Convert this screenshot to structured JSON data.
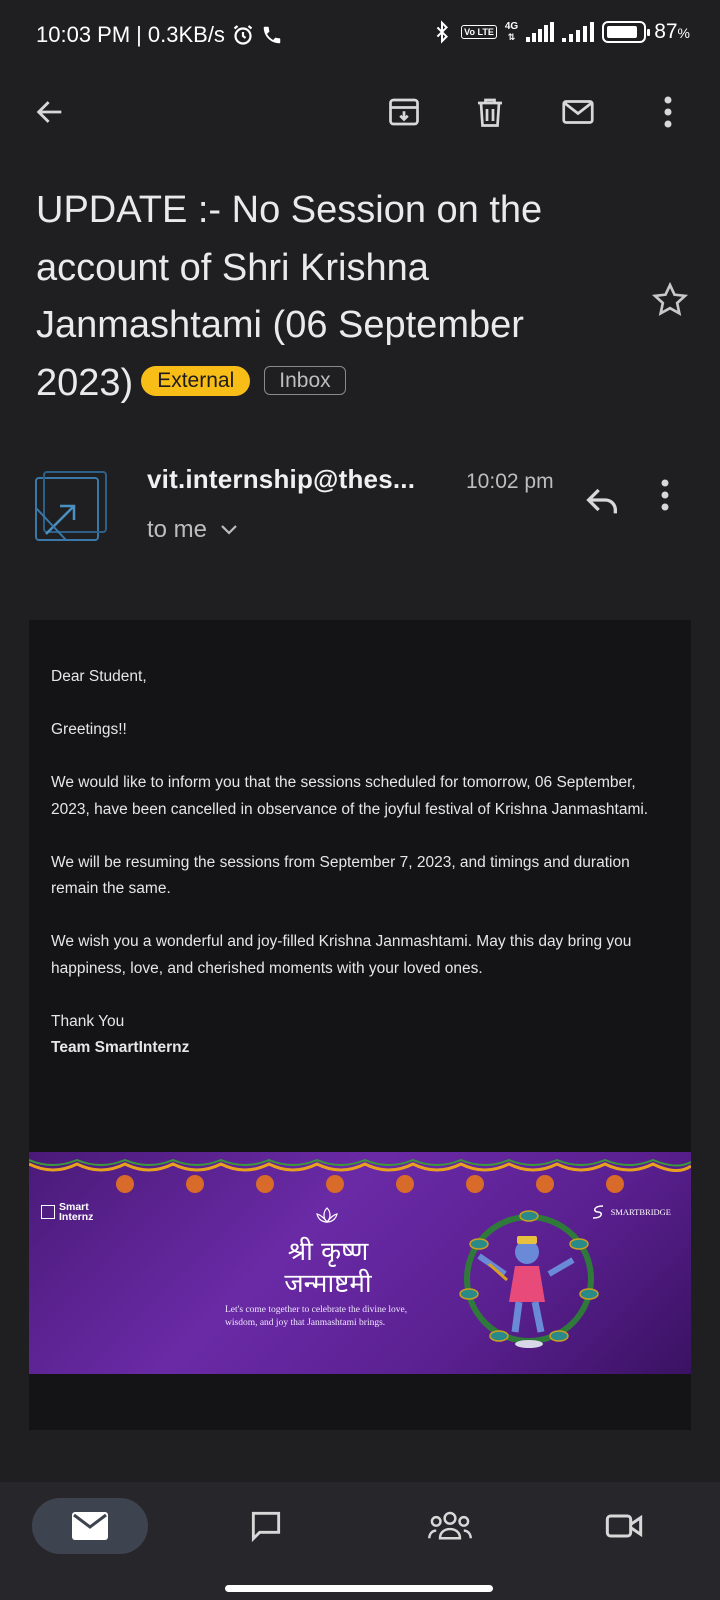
{
  "status_bar": {
    "time": "10:03 PM",
    "speed": "0.3KB/s",
    "network": "4G",
    "volte": "Vo LTE",
    "battery": "87",
    "battery_unit": "%",
    "battery_level": 0.87
  },
  "toolbar": {
    "back_icon": "arrow-left-icon",
    "archive_icon": "archive-icon",
    "delete_icon": "trash-icon",
    "mark_unread_icon": "envelope-icon",
    "more_icon": "more-vertical-icon"
  },
  "email": {
    "subject": "UPDATE :- No Session on the account of Shri Krishna Janmashtami (06 September 2023)",
    "labels": {
      "external": "External",
      "inbox": "Inbox"
    },
    "sender": "vit.internship@thes...",
    "time": "10:02 pm",
    "recipient": "to me",
    "body": {
      "greeting": "Dear Student,",
      "line1": "Greetings!!",
      "para1": "We would like to inform you that the sessions scheduled for tomorrow, 06 September, 2023, have been cancelled in observance of the joyful festival of Krishna Janmashtami.",
      "para2": "We will be resuming the sessions from September 7, 2023, and timings and duration remain the same.",
      "para3": "We wish you a wonderful and joy-filled Krishna Janmashtami. May this day bring you happiness, love, and cherished moments with your loved ones.",
      "closing": "Thank You",
      "signature": "Team SmartInternz"
    },
    "banner": {
      "logo_left_line1": "Smart",
      "logo_left_line2": "Internz",
      "logo_right": "SMARTBRIDGE",
      "title_line1": "श्री कृष्ण",
      "title_line2": "जन्माष्टमी",
      "tagline_line1": "Let's come together to celebrate the divine love,",
      "tagline_line2": "wisdom, and joy that Janmashtami brings."
    }
  },
  "bottom_nav": {
    "items": [
      {
        "icon": "mail-icon",
        "active": true
      },
      {
        "icon": "chat-icon",
        "active": false
      },
      {
        "icon": "spaces-icon",
        "active": false
      },
      {
        "icon": "meet-icon",
        "active": false
      }
    ]
  },
  "colors": {
    "background": "#1f1f22",
    "body_card": "#141416",
    "external_chip": "#f9bd18",
    "nav_active": "#3e4350"
  }
}
